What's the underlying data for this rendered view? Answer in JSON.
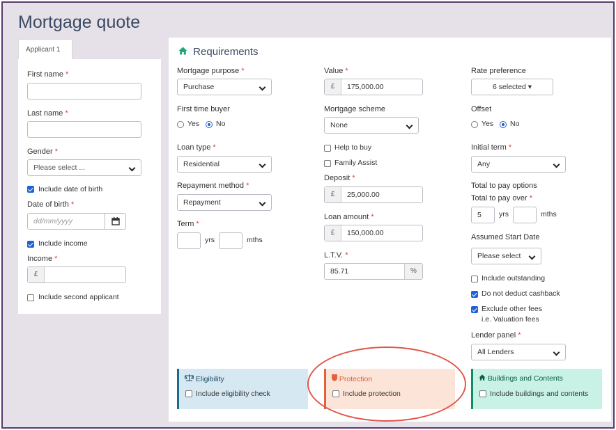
{
  "page": {
    "title": "Mortgage quote"
  },
  "applicant": {
    "tab_label": "Applicant 1",
    "first_name": {
      "label": "First name",
      "required": "*",
      "value": ""
    },
    "last_name": {
      "label": "Last name",
      "required": "*",
      "value": ""
    },
    "gender": {
      "label": "Gender",
      "required": "*",
      "value": "Please select ..."
    },
    "include_dob": {
      "label": "Include date of birth",
      "checked": true
    },
    "dob": {
      "label": "Date of birth",
      "required": "*",
      "placeholder": "dd/mm/yyyy"
    },
    "include_income": {
      "label": "Include income",
      "checked": true
    },
    "income": {
      "label": "Income",
      "required": "*",
      "prefix": "£",
      "value": ""
    },
    "include_second": {
      "label": "Include second applicant",
      "checked": false
    }
  },
  "requirements": {
    "title": "Requirements",
    "mortgage_purpose": {
      "label": "Mortgage purpose",
      "required": "*",
      "value": "Purchase"
    },
    "first_time_buyer": {
      "label": "First time buyer",
      "options": [
        "Yes",
        "No"
      ],
      "selected": "No"
    },
    "loan_type": {
      "label": "Loan type",
      "required": "*",
      "value": "Residential"
    },
    "repayment_method": {
      "label": "Repayment method",
      "required": "*",
      "value": "Repayment"
    },
    "term": {
      "label": "Term",
      "required": "*",
      "years_unit": "yrs",
      "months_unit": "mths",
      "years": "",
      "months": ""
    },
    "value": {
      "label": "Value",
      "required": "*",
      "prefix": "£",
      "value": "175,000.00"
    },
    "mortgage_scheme": {
      "label": "Mortgage scheme",
      "value": "None"
    },
    "help_to_buy": {
      "label": "Help to buy",
      "checked": false
    },
    "family_assist": {
      "label": "Family Assist",
      "checked": false
    },
    "deposit": {
      "label": "Deposit",
      "required": "*",
      "prefix": "£",
      "value": "25,000.00"
    },
    "loan_amount": {
      "label": "Loan amount",
      "required": "*",
      "prefix": "£",
      "value": "150,000.00"
    },
    "ltv": {
      "label": "L.T.V.",
      "required": "*",
      "value": "85.71",
      "suffix": "%"
    },
    "rate_preference": {
      "label": "Rate preference",
      "value": "6 selected ▾"
    },
    "offset": {
      "label": "Offset",
      "options": [
        "Yes",
        "No"
      ],
      "selected": "No"
    },
    "initial_term": {
      "label": "Initial term",
      "required": "*",
      "value": "Any"
    },
    "total_to_pay_options": {
      "label": "Total to pay options"
    },
    "total_to_pay_over": {
      "label": "Total to pay over",
      "required": "*",
      "years": "5",
      "years_unit": "yrs",
      "months": "",
      "months_unit": "mths"
    },
    "assumed_start_date": {
      "label": "Assumed Start Date",
      "value": "Please select"
    },
    "include_outstanding": {
      "label": "Include outstanding",
      "checked": false
    },
    "do_not_deduct_cashback": {
      "label": "Do not deduct cashback",
      "checked": true
    },
    "exclude_other_fees": {
      "label": "Exclude other fees",
      "sublabel": "i.e. Valuation fees",
      "checked": true
    },
    "lender_panel": {
      "label": "Lender panel",
      "required": "*",
      "value": "All Lenders"
    }
  },
  "cards": {
    "eligibility": {
      "title": "Eligibility",
      "icon": "scales-icon",
      "checkbox_label": "Include eligibility check",
      "checked": false,
      "color": "#1b6b8c"
    },
    "protection": {
      "title": "Protection",
      "icon": "shield-icon",
      "checkbox_label": "Include protection",
      "checked": false,
      "color": "#e0623a"
    },
    "buildings": {
      "title": "Buildings and Contents",
      "icon": "house-icon",
      "checkbox_label": "Include buildings and contents",
      "checked": false,
      "color": "#118a66"
    }
  }
}
